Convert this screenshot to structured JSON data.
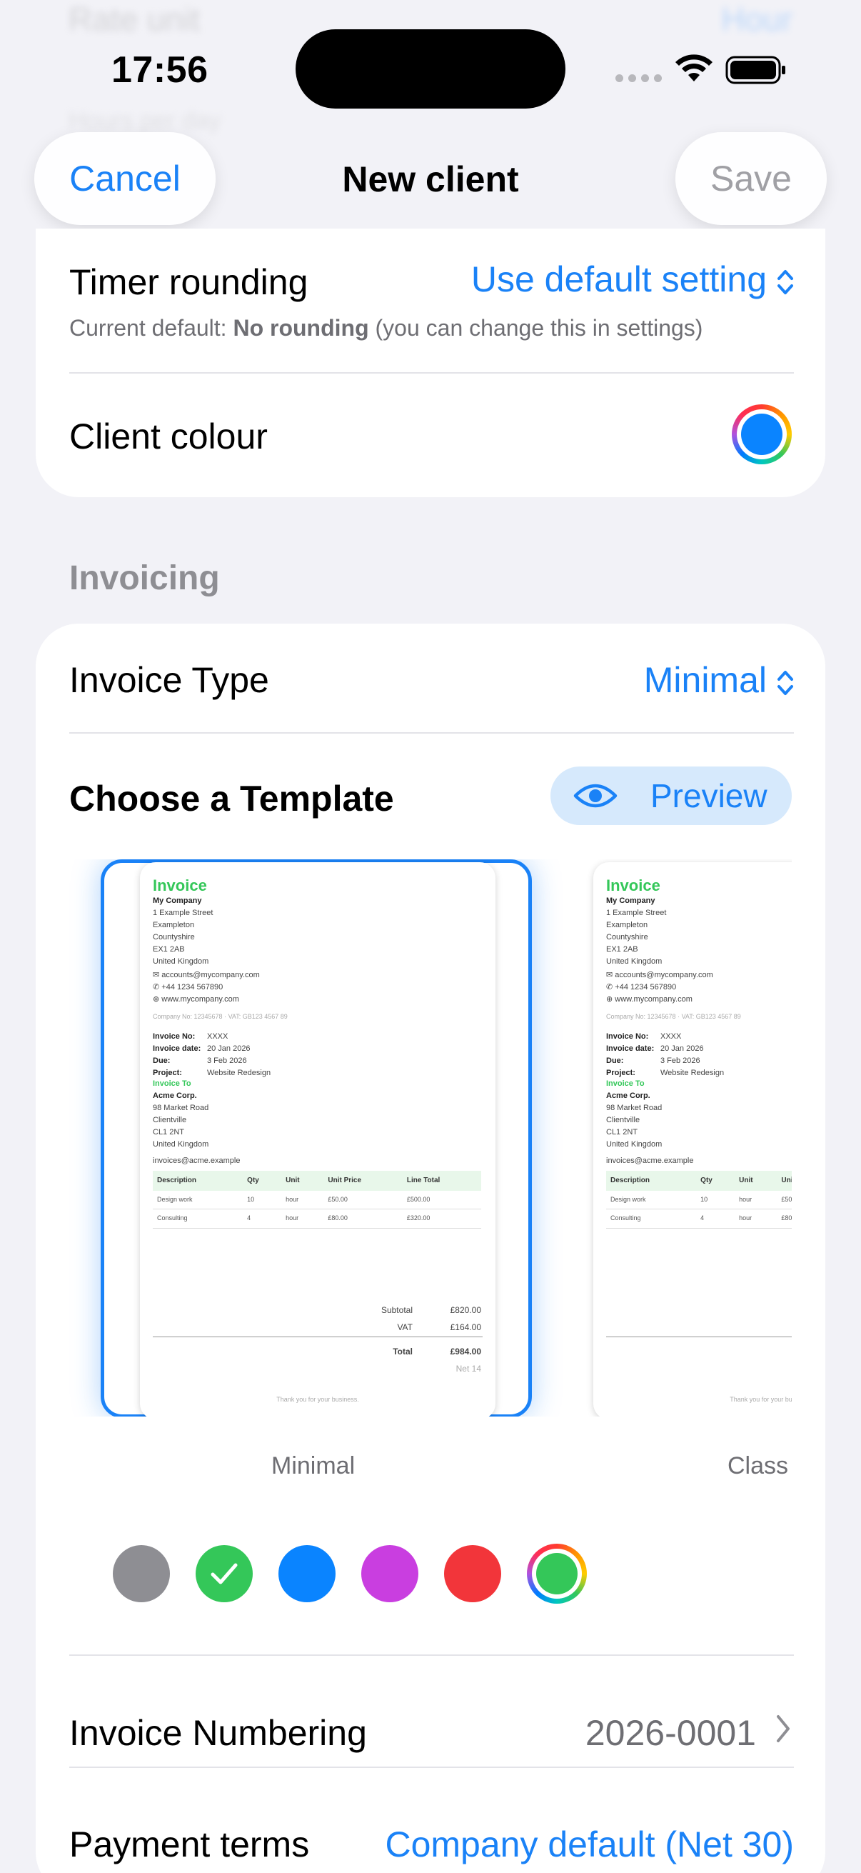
{
  "ghost": {
    "left_text": "Rate unit",
    "right_text": "Hour",
    "below_text": "Hours per day"
  },
  "status": {
    "time": "17:56"
  },
  "nav": {
    "cancel": "Cancel",
    "title": "New client",
    "save": "Save"
  },
  "timer": {
    "label": "Timer rounding",
    "value": "Use default setting",
    "note_prefix": "Current default: ",
    "note_bold": "No rounding",
    "note_suffix": " (you can change this in settings)"
  },
  "client_colour": {
    "label": "Client colour",
    "color": "#0a84ff"
  },
  "invoicing": {
    "header": "Invoicing",
    "type_label": "Invoice Type",
    "type_value": "Minimal",
    "template_heading": "Choose a Template",
    "preview_label": "Preview",
    "templates": [
      {
        "caption": "Minimal"
      },
      {
        "caption": "Class"
      }
    ],
    "invoice_sample": {
      "title": "Invoice",
      "company": "My Company",
      "address": [
        "1 Example Street",
        "Exampleton",
        "Countyshire",
        "EX1 2AB",
        "United Kingdom"
      ],
      "contact": [
        "accounts@mycompany.com",
        "+44 1234 567890",
        "www.mycompany.com"
      ],
      "company_reg": "Company No: 12345678 · VAT: GB123 4567 89",
      "meta": [
        {
          "k": "Invoice No:",
          "v": "XXXX"
        },
        {
          "k": "Invoice date:",
          "v": "20 Jan 2026"
        },
        {
          "k": "Due:",
          "v": "3 Feb 2026"
        },
        {
          "k": "Project:",
          "v": "Website Redesign"
        }
      ],
      "invoice_to": "Invoice To",
      "client": "Acme Corp.",
      "client_address": [
        "98 Market Road",
        "Clientville",
        "CL1 2NT",
        "United Kingdom"
      ],
      "client_email": "invoices@acme.example",
      "columns": [
        "Description",
        "Qty",
        "Unit",
        "Unit Price",
        "Line Total"
      ],
      "rows": [
        [
          "Design work",
          "10",
          "hour",
          "£50.00",
          "£500.00"
        ],
        [
          "Consulting",
          "4",
          "hour",
          "£80.00",
          "£320.00"
        ]
      ],
      "subtotal_label": "Subtotal",
      "subtotal": "£820.00",
      "vat_label": "VAT",
      "vat": "£164.00",
      "total_label": "Total",
      "total": "£984.00",
      "total_note": "Net 14",
      "footer": "Thank you for your business."
    },
    "swatches": [
      "#8e8e93",
      "#34c759",
      "#0a84ff",
      "#c93ee0",
      "#f2353a",
      "#34c759"
    ],
    "selected_swatch": 1,
    "numbering_label": "Invoice Numbering",
    "numbering_value": "2026-0001",
    "payment_label": "Payment terms",
    "payment_value": "Company default (Net 30)"
  }
}
